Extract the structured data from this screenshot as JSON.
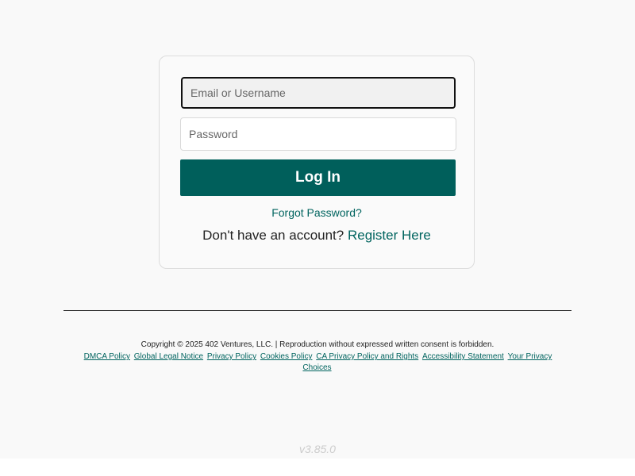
{
  "login": {
    "email_placeholder": "Email or Username",
    "password_placeholder": "Password",
    "login_label": "Log In",
    "forgot_label": "Forgot Password?",
    "no_account_text": "Don't have an account? ",
    "register_label": "Register Here"
  },
  "footer": {
    "copyright": "Copyright © 2025 402 Ventures, LLC. | Reproduction without expressed written consent is forbidden.",
    "links": [
      "DMCA Policy",
      "Global Legal Notice",
      "Privacy Policy",
      "Cookies Policy",
      "CA Privacy Policy and Rights",
      "Accessibility Statement",
      "Your Privacy Choices"
    ],
    "version": "v3.85.0"
  },
  "colors": {
    "accent": "#005f5b",
    "link": "#00645f",
    "background": "#f9f9f9"
  }
}
